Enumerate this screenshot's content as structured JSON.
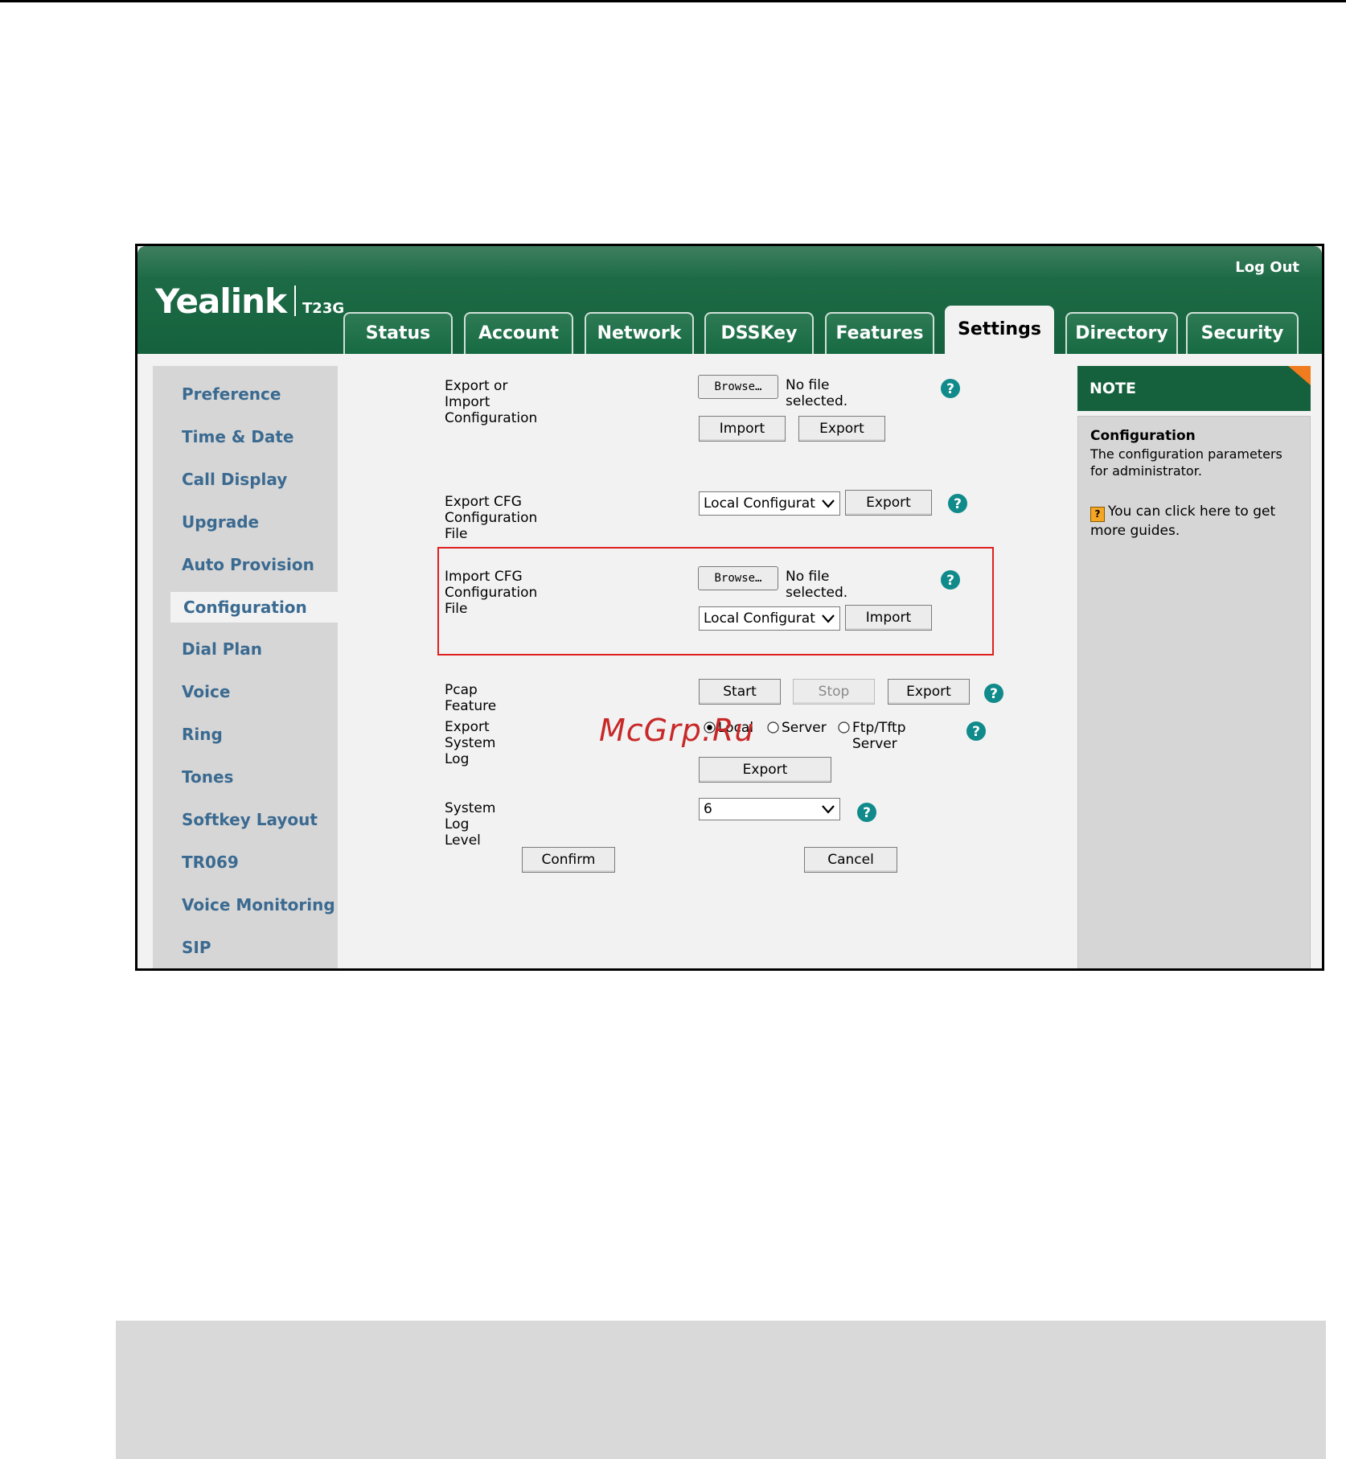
{
  "header": {
    "logo": "Yealink",
    "model": "T23G",
    "logout": "Log Out"
  },
  "tabs": [
    "Status",
    "Account",
    "Network",
    "DSSKey",
    "Features",
    "Settings",
    "Directory",
    "Security"
  ],
  "active_tab": "Settings",
  "sidebar": {
    "items": [
      "Preference",
      "Time & Date",
      "Call Display",
      "Upgrade",
      "Auto Provision",
      "Configuration",
      "Dial Plan",
      "Voice",
      "Ring",
      "Tones",
      "Softkey Layout",
      "TR069",
      "Voice Monitoring",
      "SIP"
    ],
    "active": "Configuration"
  },
  "main": {
    "export_import": {
      "label": "Export or Import Configuration",
      "browse": "Browse…",
      "no_file": "No file selected.",
      "import_btn": "Import",
      "export_btn": "Export"
    },
    "export_cfg": {
      "label": "Export CFG Configuration File",
      "select_value": "Local Configuration",
      "export_btn": "Export"
    },
    "import_cfg": {
      "label": "Import CFG Configuration File",
      "browse": "Browse…",
      "no_file": "No file selected.",
      "select_value": "Local Configuration",
      "import_btn": "Import"
    },
    "pcap": {
      "label": "Pcap Feature",
      "start_btn": "Start",
      "stop_btn": "Stop",
      "export_btn": "Export"
    },
    "system_log": {
      "label": "Export System Log",
      "options": [
        "Local",
        "Server",
        "Ftp/Tftp Server"
      ],
      "selected": "Local",
      "export_btn": "Export"
    },
    "log_level": {
      "label": "System Log Level",
      "value": "6"
    },
    "confirm_btn": "Confirm",
    "cancel_btn": "Cancel"
  },
  "note": {
    "heading": "NOTE",
    "title": "Configuration",
    "description": "The configuration parameters for administrator.",
    "guide": "You can click here to get more guides.",
    "guide_icon": "?"
  },
  "watermark": "McGrp.Ru",
  "colors": {
    "header_green": "#15613d",
    "nav_link": "#3b6a91",
    "highlight_red": "#e02020",
    "help_teal": "#108a8a",
    "note_corner": "#f07c1f"
  }
}
